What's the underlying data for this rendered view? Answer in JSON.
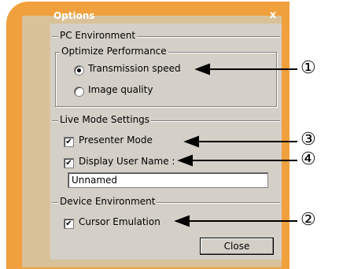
{
  "window": {
    "title": "Options",
    "close_glyph": "x"
  },
  "pc_environment": {
    "group_label": "PC Environment",
    "optimize": {
      "group_label": "Optimize Performance",
      "options": [
        {
          "label": "Transmission speed",
          "selected": true
        },
        {
          "label": "Image quality",
          "selected": false
        }
      ]
    }
  },
  "live_mode": {
    "group_label": "Live Mode Settings",
    "presenter_mode": {
      "label": "Presenter Mode",
      "checked": true
    },
    "display_user_name": {
      "label": "Display User Name :",
      "checked": true
    },
    "user_name_value": "Unnamed"
  },
  "device_environment": {
    "group_label": "Device Environment",
    "cursor_emulation": {
      "label": "Cursor Emulation",
      "checked": true
    }
  },
  "close_button": {
    "label": "Close"
  },
  "callouts": {
    "c1": "①",
    "c2": "②",
    "c3": "③",
    "c4": "④"
  },
  "colors": {
    "frame": "#f0a03c",
    "panel": "#d4d0c8"
  }
}
